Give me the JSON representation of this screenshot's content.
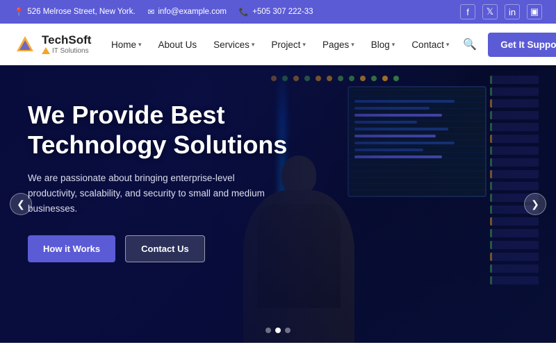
{
  "topbar": {
    "address": "526 Melrose Street, New York.",
    "email": "info@example.com",
    "phone": "+505 307 222-33",
    "address_icon": "📍",
    "email_icon": "✉",
    "phone_icon": "📞",
    "social": [
      {
        "name": "facebook",
        "label": "f"
      },
      {
        "name": "twitter",
        "label": "t"
      },
      {
        "name": "linkedin",
        "label": "in"
      },
      {
        "name": "instagram",
        "label": "ig"
      }
    ]
  },
  "logo": {
    "name": "TechSoft",
    "tagline": "IT Solutions"
  },
  "nav": {
    "items": [
      {
        "label": "Home",
        "has_dropdown": true
      },
      {
        "label": "About Us",
        "has_dropdown": false
      },
      {
        "label": "Services",
        "has_dropdown": true
      },
      {
        "label": "Project",
        "has_dropdown": true
      },
      {
        "label": "Pages",
        "has_dropdown": true
      },
      {
        "label": "Blog",
        "has_dropdown": true
      },
      {
        "label": "Contact",
        "has_dropdown": true
      }
    ],
    "cta_label": "Get It Support"
  },
  "hero": {
    "title_line1": "We Provide Best",
    "title_line2": "Technology Solutions",
    "subtitle": "We are passionate about bringing enterprise-level productivity, scalability, and security to small and medium businesses.",
    "btn_primary": "How it Works",
    "btn_secondary": "Contact Us",
    "arrow_left": "❮",
    "arrow_right": "❯",
    "dots": [
      {
        "active": false
      },
      {
        "active": true
      },
      {
        "active": false
      }
    ]
  },
  "colors": {
    "brand": "#5b5bd6",
    "dark_bg": "#0a0f3c",
    "accent_orange": "#f5a623",
    "accent_green": "#4CAF50",
    "text_white": "#ffffff",
    "text_light": "#ddddee"
  }
}
